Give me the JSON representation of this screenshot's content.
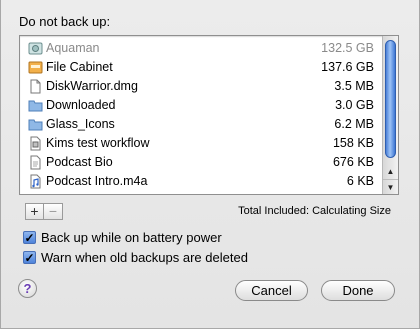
{
  "dialog": {
    "heading": "Do not back up:",
    "items": [
      {
        "icon": "drive-icon",
        "name": "Aquaman",
        "size": "132.5 GB",
        "disabled": true
      },
      {
        "icon": "volume-icon",
        "name": "File Cabinet",
        "size": "137.6 GB",
        "disabled": false
      },
      {
        "icon": "document-icon",
        "name": "DiskWarrior.dmg",
        "size": "3.5 MB",
        "disabled": false
      },
      {
        "icon": "folder-icon",
        "name": "Downloaded",
        "size": "3.0 GB",
        "disabled": false
      },
      {
        "icon": "folder-icon",
        "name": "Glass_Icons",
        "size": "6.2 MB",
        "disabled": false
      },
      {
        "icon": "workflow-icon",
        "name": "Kims test workflow",
        "size": "158 KB",
        "disabled": false
      },
      {
        "icon": "document-icon",
        "name": "Podcast Bio",
        "size": "676 KB",
        "disabled": false
      },
      {
        "icon": "audio-file-icon",
        "name": "Podcast Intro.m4a",
        "size": "6 KB",
        "disabled": false
      }
    ],
    "add_label": "+",
    "remove_label": "−",
    "total_text": "Total Included: Calculating Size",
    "checkboxes": [
      {
        "label": "Back up while on battery power",
        "checked": true
      },
      {
        "label": "Warn when old backups are deleted",
        "checked": true
      }
    ],
    "help_label": "?",
    "cancel_label": "Cancel",
    "done_label": "Done",
    "accent_color": "#4f84da"
  }
}
